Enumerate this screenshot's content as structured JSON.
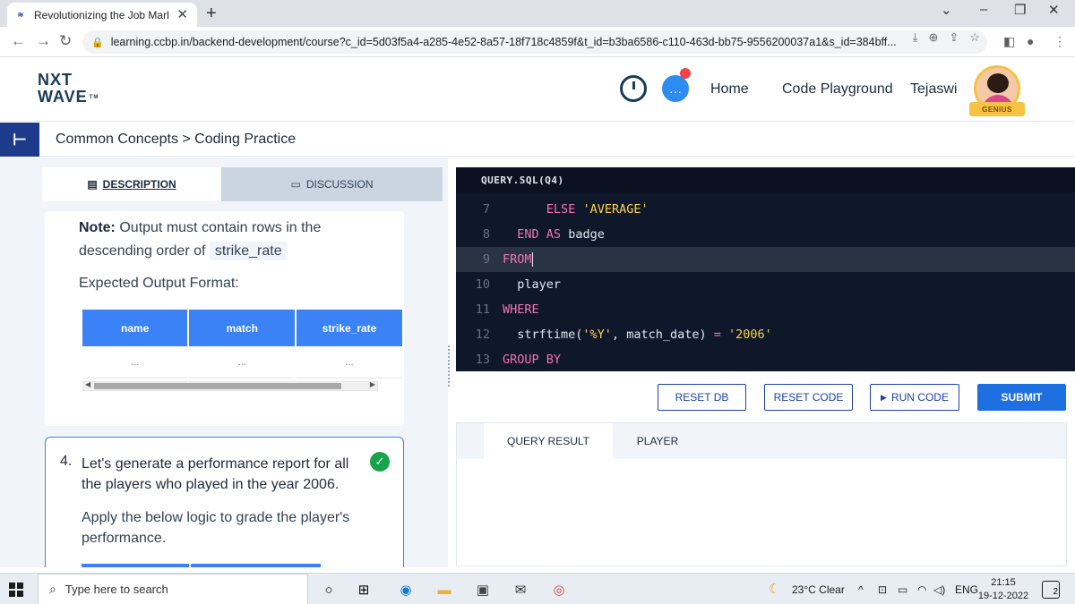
{
  "browser": {
    "tab_title": "Revolutionizing the Job Market |",
    "url": "learning.ccbp.in/backend-development/course?c_id=5d03f5a4-a285-4e52-8a57-18f718c4859f&t_id=b3ba6586-c110-463d-bb75-9556200037a1&s_id=384bff...",
    "new_tab": "+",
    "close_tab": "✕"
  },
  "header": {
    "logo_line1": "NXT",
    "logo_line2": "WAVE",
    "logo_tm": "TM",
    "nav": [
      "Home",
      "Code Playground",
      "Tejaswi"
    ],
    "badge": "GENIUS"
  },
  "breadcrumb": {
    "text": "Common Concepts > Coding Practice"
  },
  "left_panel": {
    "tabs": [
      "DESCRIPTION",
      "DISCUSSION"
    ],
    "note_label": "Note:",
    "note_text": "Output must contain rows in the descending order of",
    "note_code": "strike_rate",
    "expected_label": "Expected Output Format:",
    "output_table": {
      "headers": [
        "name",
        "match",
        "strike_rate"
      ],
      "row": [
        "...",
        "...",
        "..."
      ]
    },
    "question_number": "4.",
    "question_text": "Let's generate a performance report for all the players who played in the year 2006.",
    "logic_text": "Apply the below logic to grade the player's performance."
  },
  "editor": {
    "title": "QUERY.SQL(Q4)",
    "lines": [
      {
        "num": "7",
        "indent": "   ",
        "parts": [
          {
            "t": "ELSE",
            "c": "kw"
          },
          {
            "t": " ",
            "c": "fn"
          },
          {
            "t": "'AVERAGE'",
            "c": "str"
          }
        ]
      },
      {
        "num": "8",
        "indent": " ",
        "parts": [
          {
            "t": "END",
            "c": "kw"
          },
          {
            "t": " ",
            "c": "fn"
          },
          {
            "t": "AS",
            "c": "kw"
          },
          {
            "t": " badge",
            "c": "fn"
          }
        ]
      },
      {
        "num": "9",
        "indent": "",
        "parts": [
          {
            "t": "FROM",
            "c": "kw"
          }
        ],
        "active": true
      },
      {
        "num": "10",
        "indent": " ",
        "parts": [
          {
            "t": "player",
            "c": "fn"
          }
        ]
      },
      {
        "num": "11",
        "indent": "",
        "parts": [
          {
            "t": "WHERE",
            "c": "kw"
          }
        ]
      },
      {
        "num": "12",
        "indent": " ",
        "parts": [
          {
            "t": "strftime(",
            "c": "fn"
          },
          {
            "t": "'%Y'",
            "c": "str"
          },
          {
            "t": ", match_date) ",
            "c": "fn"
          },
          {
            "t": "=",
            "c": "kw"
          },
          {
            "t": " ",
            "c": "fn"
          },
          {
            "t": "'2006'",
            "c": "str"
          }
        ]
      },
      {
        "num": "13",
        "indent": "",
        "parts": [
          {
            "t": "GROUP BY",
            "c": "kw"
          }
        ]
      }
    ]
  },
  "buttons": {
    "reset_db": "RESET DB",
    "reset_code": "RESET CODE",
    "run_code": "RUN CODE",
    "submit": "SUBMIT"
  },
  "result": {
    "tabs": [
      "QUERY RESULT",
      "PLAYER"
    ]
  },
  "taskbar": {
    "search_placeholder": "Type here to search",
    "weather": "23°C  Clear",
    "language": "ENG",
    "time": "21:15",
    "date": "19-12-2022",
    "notifications": "2"
  },
  "colors": {
    "accent": "#3b82f6",
    "brand_dark": "#1e3a8a",
    "editor_bg": "#0f172a",
    "success": "#16a34a"
  }
}
